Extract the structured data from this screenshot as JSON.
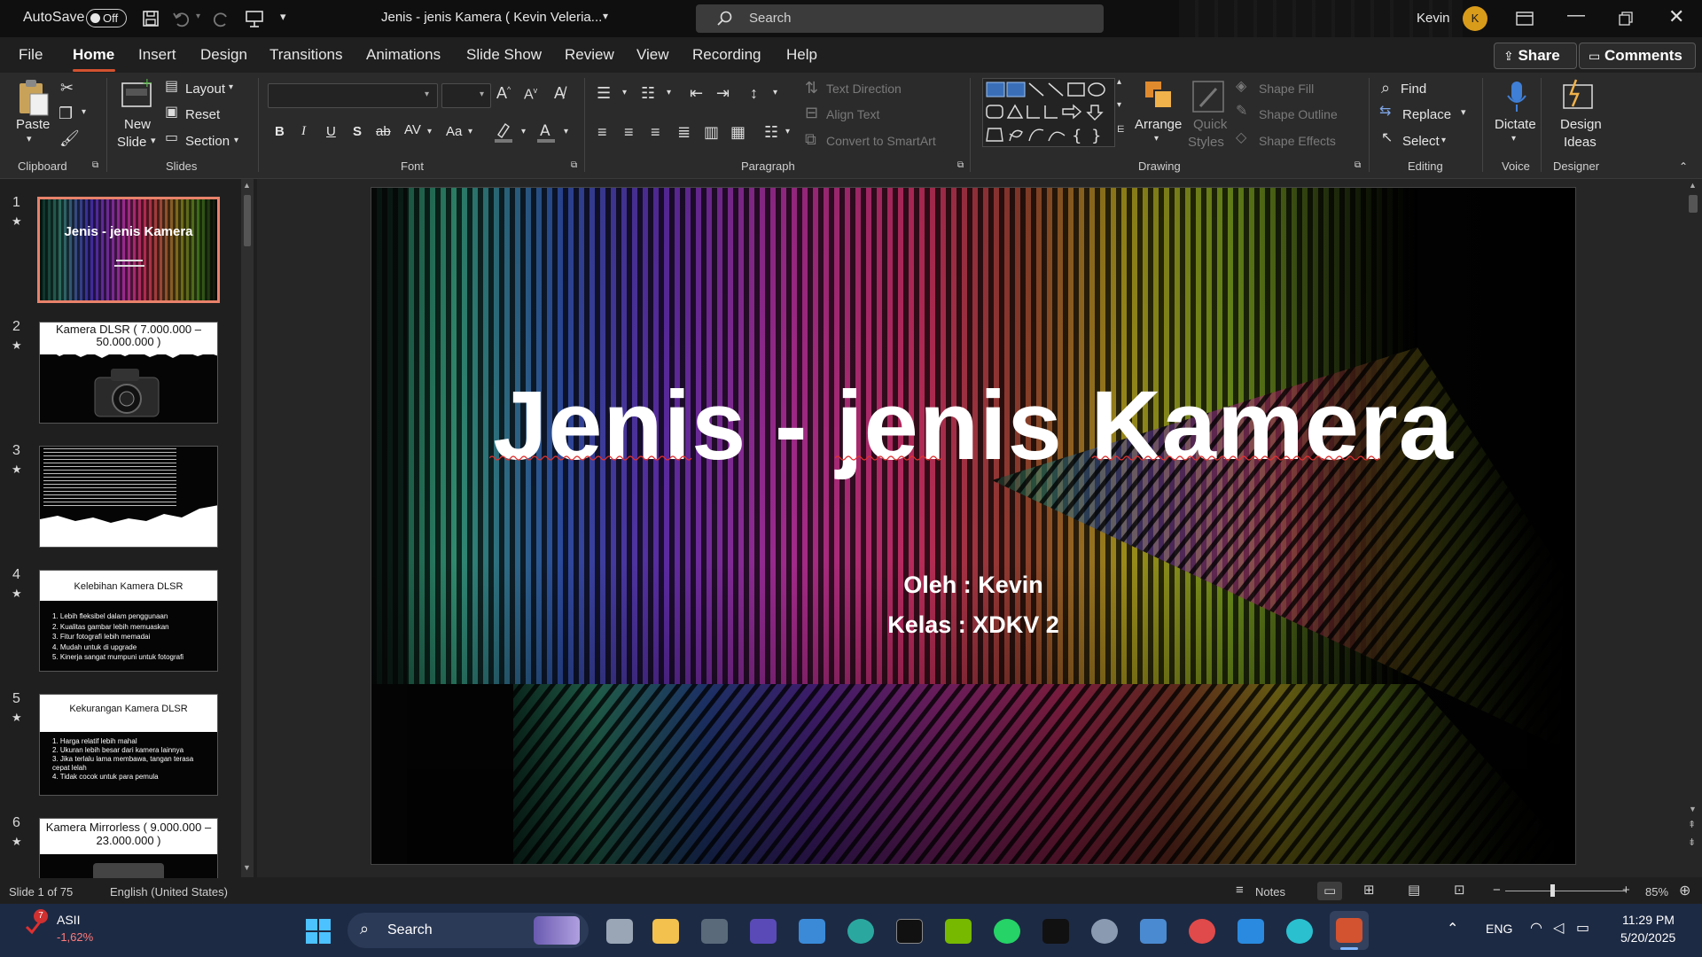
{
  "titlebar": {
    "autosave_label": "AutoSave",
    "autosave_state": "Off",
    "doc_title": "Jenis - jenis Kamera ( Kevin Veleria...",
    "search_placeholder": "Search",
    "user_name": "Kevin",
    "user_initial": "K"
  },
  "menu": {
    "tabs": [
      "File",
      "Home",
      "Insert",
      "Design",
      "Transitions",
      "Animations",
      "Slide Show",
      "Review",
      "View",
      "Recording",
      "Help"
    ],
    "active_tab": "Home",
    "share_label": "Share",
    "comments_label": "Comments"
  },
  "ribbon": {
    "clipboard": {
      "paste": "Paste",
      "group": "Clipboard"
    },
    "slides": {
      "new_slide_1": "New",
      "new_slide_2": "Slide",
      "layout": "Layout",
      "reset": "Reset",
      "section": "Section",
      "group": "Slides"
    },
    "font": {
      "group": "Font",
      "bold": "B",
      "italic": "I",
      "underline": "U",
      "shadow": "S",
      "strike": "ab",
      "spacing": "AV",
      "case": "Aa"
    },
    "paragraph": {
      "group": "Paragraph",
      "text_direction": "Text Direction",
      "align_text": "Align Text",
      "convert_smartart": "Convert to SmartArt"
    },
    "drawing": {
      "group": "Drawing",
      "arrange": "Arrange",
      "quick_styles_1": "Quick",
      "quick_styles_2": "Styles",
      "shape_fill": "Shape Fill",
      "shape_outline": "Shape Outline",
      "shape_effects": "Shape Effects"
    },
    "editing": {
      "group": "Editing",
      "find": "Find",
      "replace": "Replace",
      "select": "Select"
    },
    "voice": {
      "group": "Voice",
      "dictate": "Dictate"
    },
    "designer": {
      "group": "Designer",
      "design_ideas_1": "Design",
      "design_ideas_2": "Ideas"
    }
  },
  "thumbnails": [
    {
      "num": "1",
      "title": "Jenis - jenis Kamera"
    },
    {
      "num": "2",
      "title": "Kamera DLSR ( 7.000.000 – 50.000.000 )"
    },
    {
      "num": "3",
      "title": ""
    },
    {
      "num": "4",
      "title": "Kelebihan Kamera DLSR",
      "items": [
        "1. Lebih fleksibel dalam penggunaan",
        "2. Kualitas gambar lebih memuaskan",
        "3. Fitur fotografi lebih memadai",
        "4. Mudah untuk di upgrade",
        "5. Kinerja sangat mumpuni untuk fotografi"
      ]
    },
    {
      "num": "5",
      "title": "Kekurangan Kamera DLSR",
      "items": [
        "1. Harga relatif lebih mahal",
        "2. Ukuran lebih besar dari kamera lainnya",
        "3. Jika terlalu lama membawa, tangan terasa cepat lelah",
        "4. Tidak cocok untuk para pemula"
      ]
    },
    {
      "num": "6",
      "title": "Kamera Mirrorless ( 9.000.000 – 23.000.000 )"
    }
  ],
  "slide": {
    "title": "Jenis - jenis Kamera",
    "line1": "Oleh : Kevin",
    "line2": "Kelas : XDKV 2"
  },
  "status": {
    "slide_of": "Slide 1 of 75",
    "language": "English (United States)",
    "notes": "Notes",
    "zoom": "85%"
  },
  "taskbar": {
    "stock_name": "ASII",
    "stock_change": "-1,62%",
    "badge": "7",
    "search": "Search",
    "lang": "ENG",
    "time": "11:29 PM",
    "date": "5/20/2025"
  },
  "colors": {
    "accent": "#d35230",
    "selected_thumb_border": "#e8826a",
    "taskbar": "#1d2a44"
  }
}
